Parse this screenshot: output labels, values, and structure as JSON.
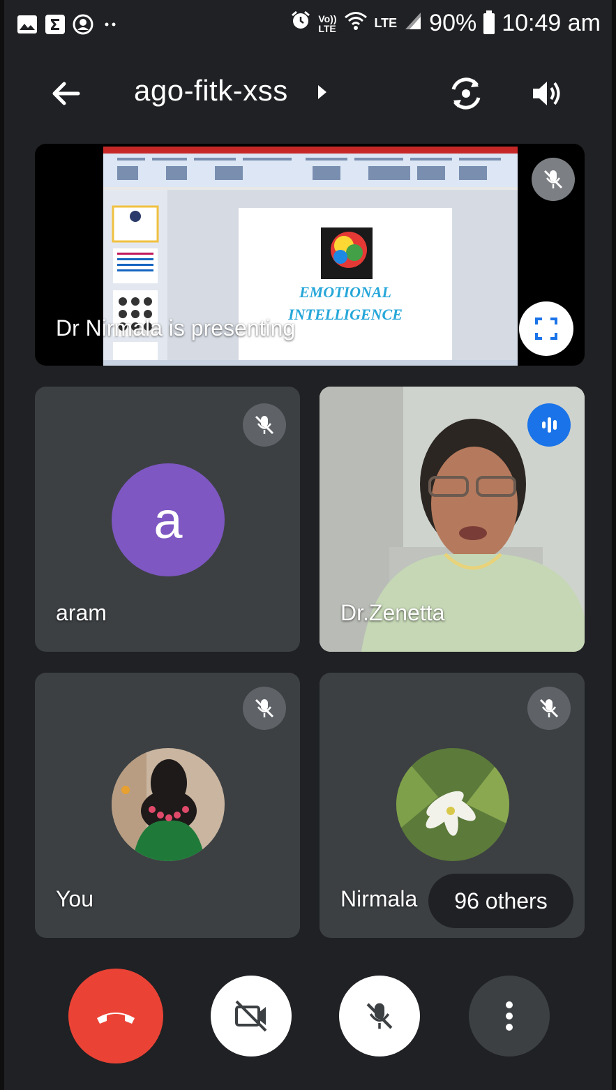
{
  "status_bar": {
    "left_icons": [
      "gallery-icon",
      "sigma-icon",
      "account-icon",
      "more-dots-icon"
    ],
    "right_icons": [
      "alarm-icon",
      "volte-icon",
      "wifi-icon",
      "lte-icon",
      "signal-icon"
    ],
    "network_label_1": "Vo))",
    "network_label_2": "LTE",
    "battery": "90%",
    "time": "10:49 am"
  },
  "header": {
    "meeting_code": "ago-fitk-xss",
    "icons": [
      "back-arrow-icon",
      "switch-camera-icon",
      "speaker-icon"
    ]
  },
  "presentation": {
    "caption": "Dr Nirmala is presenting",
    "slide_title_1": "EMOTIONAL",
    "slide_title_2": "INTELLIGENCE",
    "muted": true
  },
  "participants": [
    {
      "name": "aram",
      "avatar_letter": "a",
      "avatar_color": "#7e57c2",
      "muted": true
    },
    {
      "name": "Dr.Zenetta",
      "speaking": true
    },
    {
      "name": "You",
      "muted": true
    },
    {
      "name": "Nirmala",
      "muted": true
    }
  ],
  "others_pill": "96 others",
  "controls": {
    "end_call_color": "#ea4335",
    "icons": [
      "end-call-icon",
      "video-off-icon",
      "mic-off-icon",
      "more-options-icon"
    ]
  }
}
